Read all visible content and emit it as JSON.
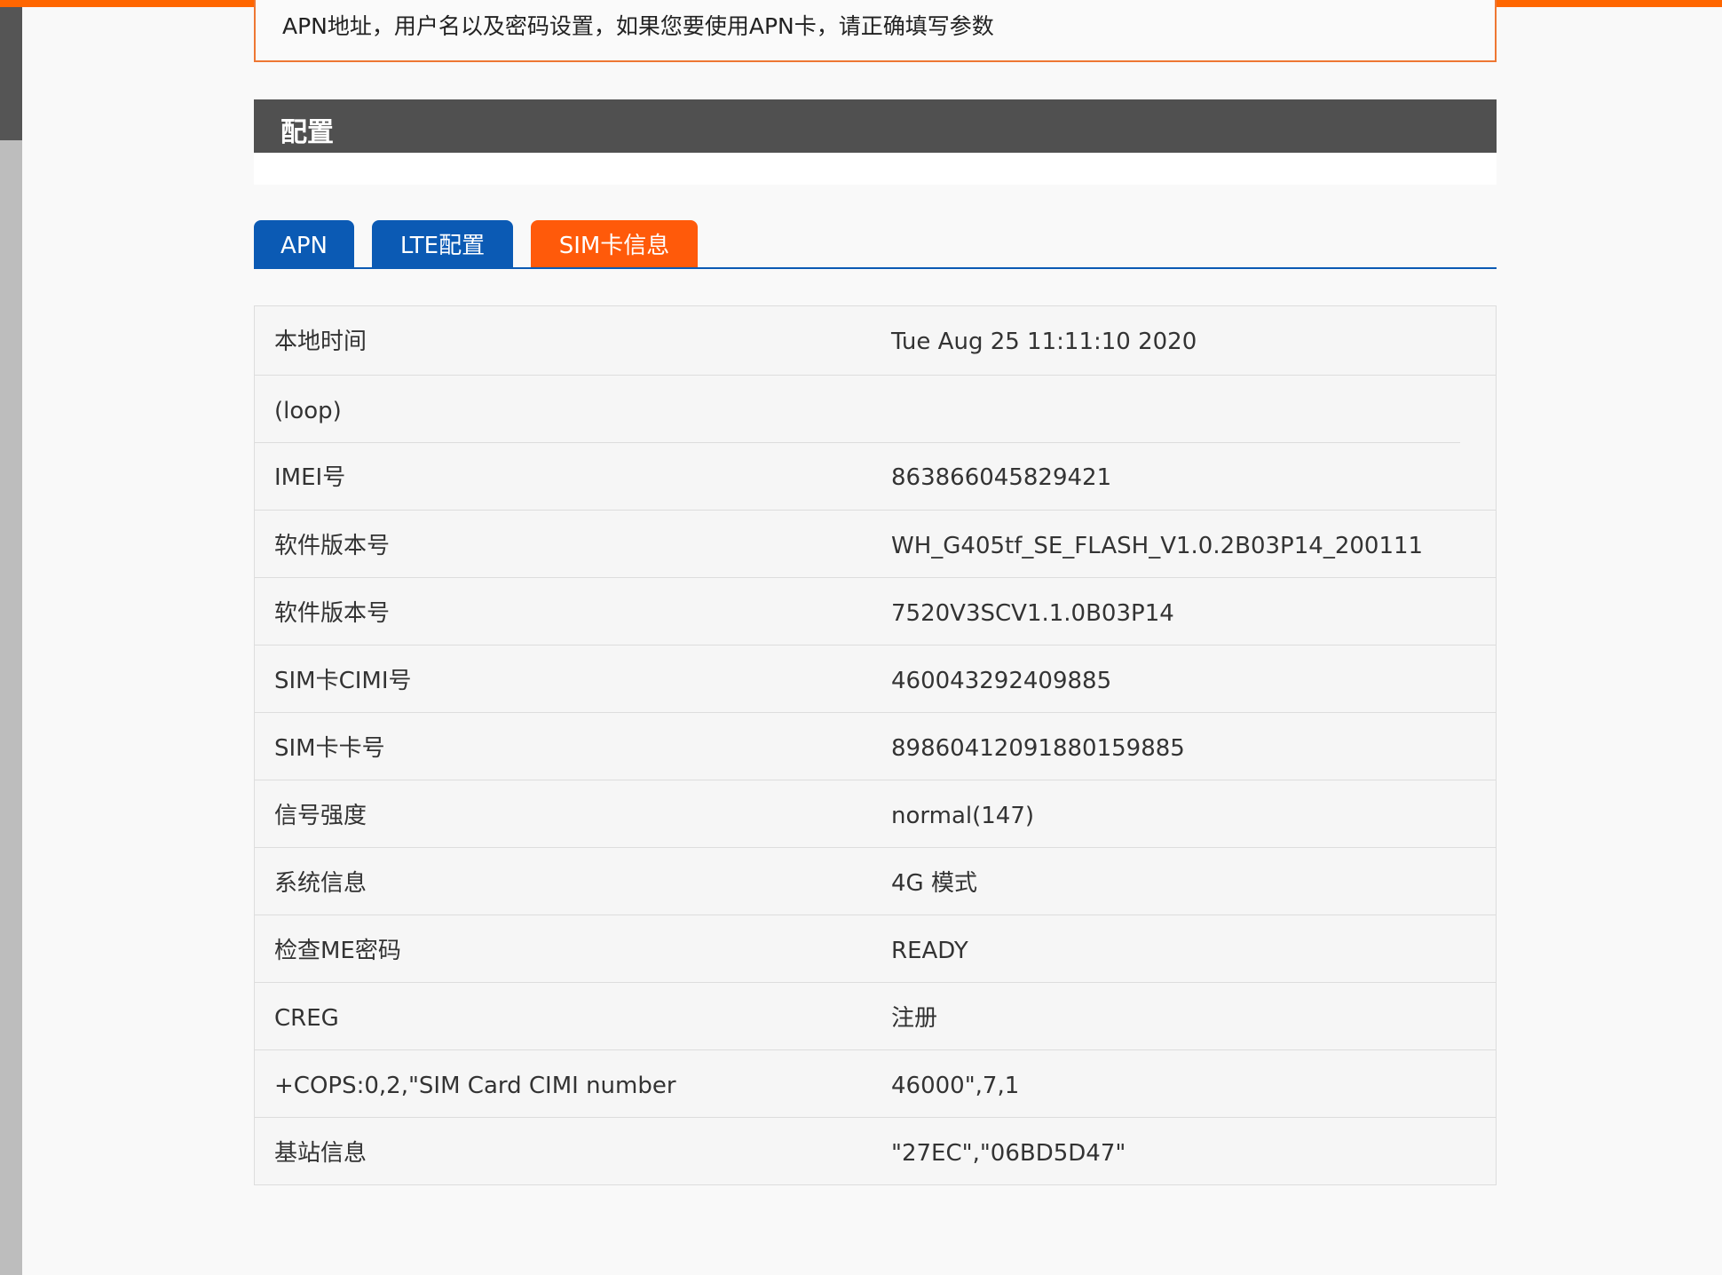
{
  "notice": {
    "text": "APN地址，用户名以及密码设置，如果您要使用APN卡，请正确填写参数"
  },
  "section": {
    "title": "配置"
  },
  "tabs": [
    {
      "label": "APN",
      "active": false
    },
    {
      "label": "LTE配置",
      "active": false
    },
    {
      "label": "SIM卡信息",
      "active": true
    }
  ],
  "colors": {
    "accent": "#ff6600",
    "tab_active": "#ff5a0a",
    "tab_inactive": "#0b5ab4",
    "header_bg": "#505050"
  },
  "info_rows": [
    {
      "label": "本地时间",
      "value": "Tue Aug 25 11:11:10 2020"
    },
    {
      "label": "(loop)",
      "value": ""
    },
    {
      "label": "IMEI号",
      "value": "863866045829421"
    },
    {
      "label": "软件版本号",
      "value": "WH_G405tf_SE_FLASH_V1.0.2B03P14_200111"
    },
    {
      "label": "软件版本号",
      "value": "7520V3SCV1.1.0B03P14"
    },
    {
      "label": "SIM卡CIMI号",
      "value": "460043292409885"
    },
    {
      "label": "SIM卡卡号",
      "value": "89860412091880159885"
    },
    {
      "label": "信号强度",
      "value": "normal(147)"
    },
    {
      "label": "系统信息",
      "value": "4G 模式"
    },
    {
      "label": "检查ME密码",
      "value": "READY"
    },
    {
      "label": "CREG",
      "value": "注册"
    },
    {
      "label": "+COPS:0,2,\"SIM Card CIMI number",
      "value": "46000\",7,1"
    },
    {
      "label": "基站信息",
      "value": "\"27EC\",\"06BD5D47\""
    }
  ]
}
